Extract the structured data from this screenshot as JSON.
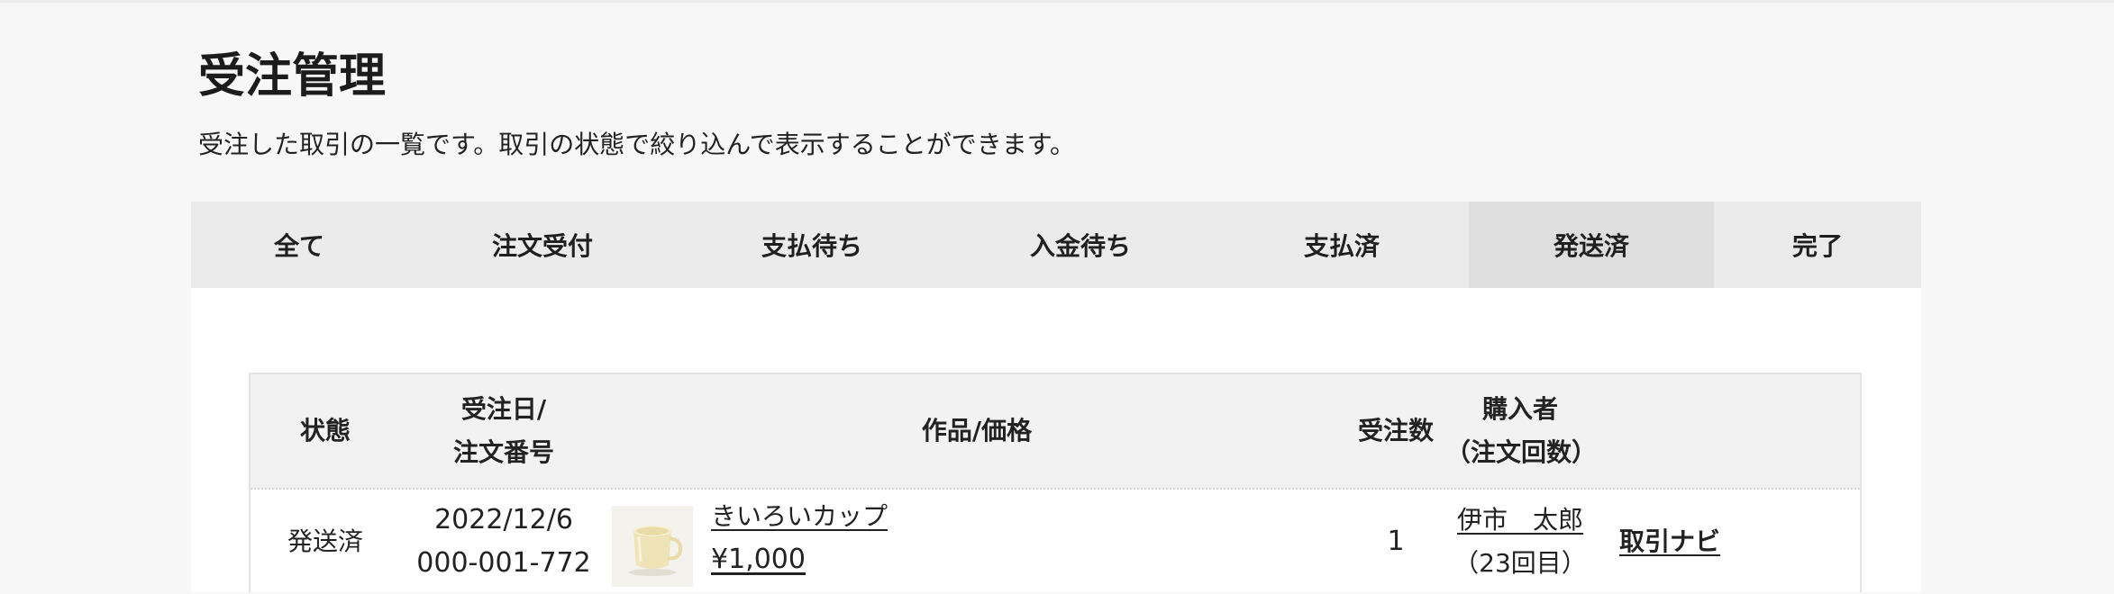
{
  "page": {
    "title": "受注管理",
    "description": "受注した取引の一覧です。取引の状態で絞り込んで表示することができます。"
  },
  "tabs": [
    {
      "label": "全て",
      "active": false
    },
    {
      "label": "注文受付",
      "active": false
    },
    {
      "label": "支払待ち",
      "active": false
    },
    {
      "label": "入金待ち",
      "active": false
    },
    {
      "label": "支払済",
      "active": false
    },
    {
      "label": "発送済",
      "active": true
    },
    {
      "label": "完了",
      "active": false
    }
  ],
  "table": {
    "headers": {
      "status": "状態",
      "date_line1": "受注日/",
      "date_line2": "注文番号",
      "product": "作品/価格",
      "quantity": "受注数",
      "buyer_line1": "購入者",
      "buyer_line2": "（注文回数）"
    },
    "rows": [
      {
        "status": "発送済",
        "date": "2022/12/6",
        "order_number": "000-001-772",
        "product_name": "きいろいカップ",
        "price": "¥1,000",
        "quantity": "1",
        "buyer_name": "伊市　太郎",
        "order_count": "（23回目）",
        "action": "取引ナビ"
      }
    ]
  },
  "colors": {
    "page_bg": "#f7f7f7",
    "tab_bar_bg": "#ebebeb",
    "tab_active_bg": "#dedede",
    "header_bg": "#f2f2f2",
    "panel_bg": "#ffffff"
  }
}
